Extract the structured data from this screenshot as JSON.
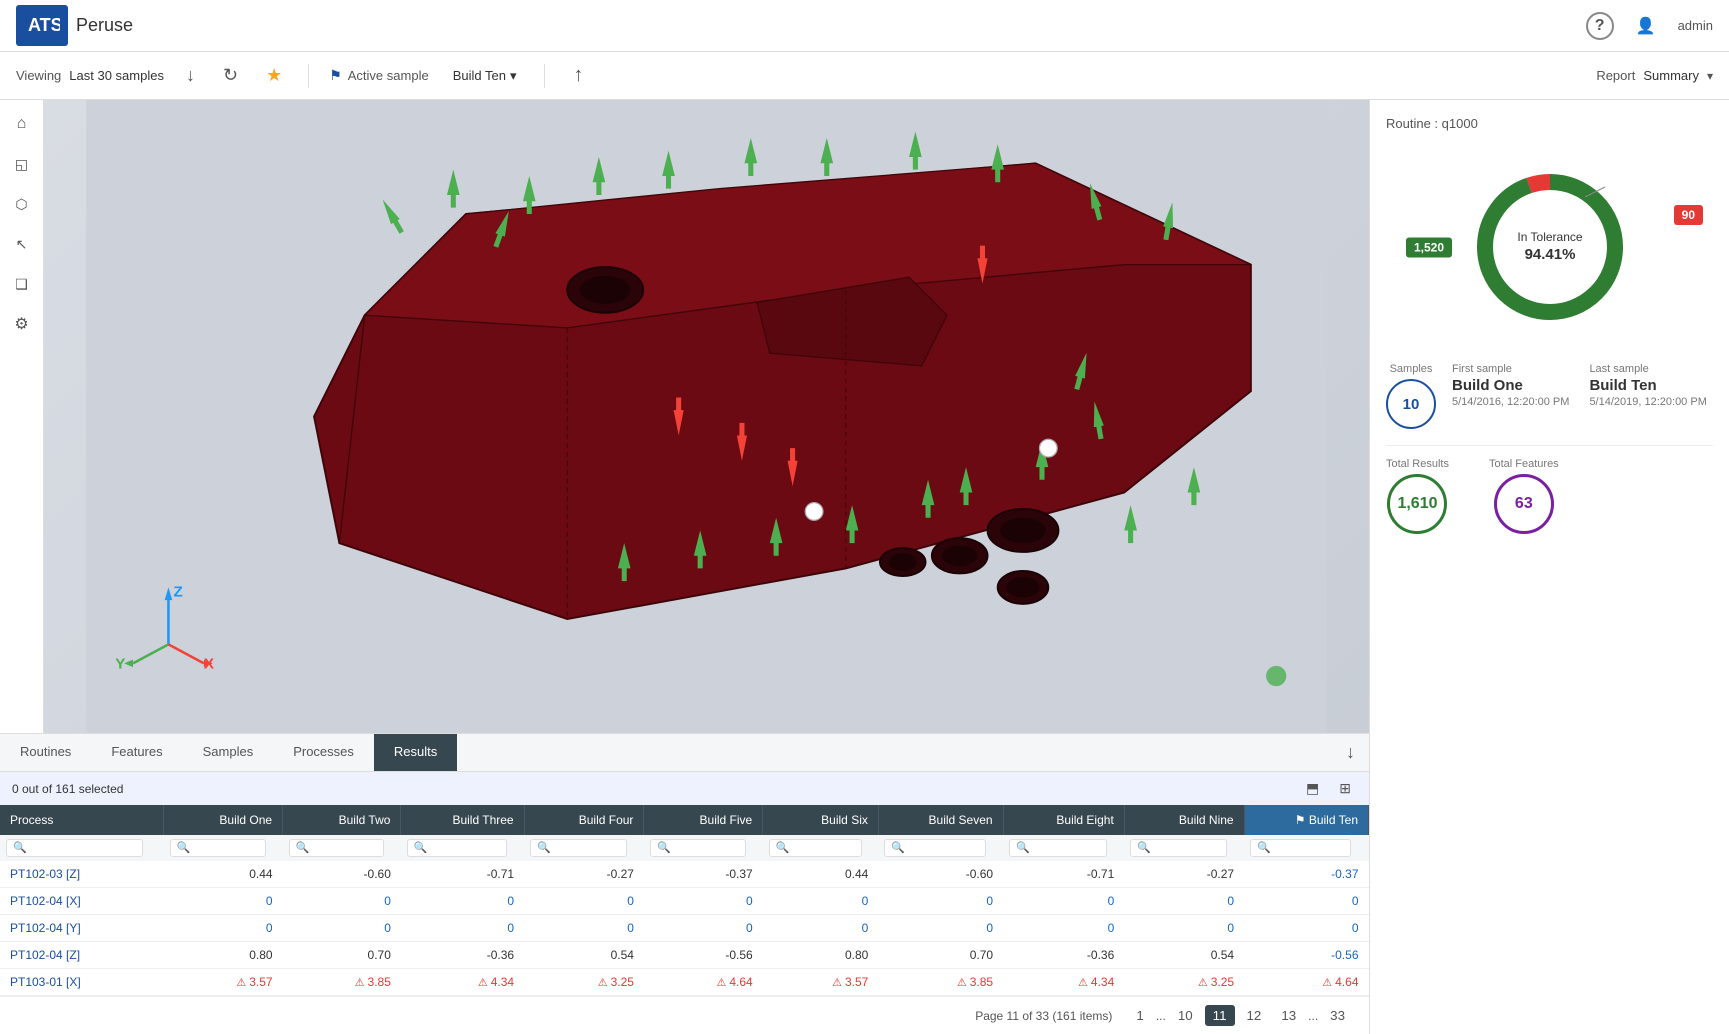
{
  "app": {
    "logo_text": "ATS",
    "app_name": "Peruse",
    "help_icon": "?",
    "user_icon": "👤",
    "admin_label": "admin"
  },
  "toolbar": {
    "viewing_label": "Viewing",
    "viewing_value": "Last 30 samples",
    "download_icon": "↓",
    "refresh_icon": "↻",
    "star_icon": "★",
    "active_sample_label": "Active sample",
    "build_value": "Build Ten",
    "dropdown_icon": "▾",
    "upload_icon": "↑",
    "report_label": "Report",
    "report_value": "Summary"
  },
  "side_tools": [
    {
      "name": "home",
      "icon": "⌂"
    },
    {
      "name": "measure",
      "icon": "◱"
    },
    {
      "name": "cube",
      "icon": "⬡"
    },
    {
      "name": "cursor",
      "icon": "↖"
    },
    {
      "name": "copy",
      "icon": "❑"
    },
    {
      "name": "settings",
      "icon": "⚙"
    }
  ],
  "summary": {
    "routine_label": "Routine : q1000",
    "donut": {
      "in_tolerance_label": "In Tolerance",
      "percentage": "94.41%",
      "green_count": "1,520",
      "red_count": "90",
      "green_color": "#2e7d32",
      "red_color": "#e53935"
    },
    "samples_label": "Samples",
    "samples_count": "10",
    "first_sample_label": "First sample",
    "first_sample_name": "Build One",
    "first_sample_date": "5/14/2016, 12:20:00 PM",
    "last_sample_label": "Last sample",
    "last_sample_name": "Build Ten",
    "last_sample_date": "5/14/2019, 12:20:00 PM",
    "total_results_label": "Total Results",
    "total_results_value": "1,610",
    "total_features_label": "Total Features",
    "total_features_value": "63"
  },
  "tabs": [
    {
      "id": "routines",
      "label": "Routines",
      "active": false
    },
    {
      "id": "features",
      "label": "Features",
      "active": false
    },
    {
      "id": "samples",
      "label": "Samples",
      "active": false
    },
    {
      "id": "processes",
      "label": "Processes",
      "active": false
    },
    {
      "id": "results",
      "label": "Results",
      "active": true
    }
  ],
  "table": {
    "status_text": "0 out of 161 selected",
    "columns": [
      "Process",
      "Build One",
      "Build Two",
      "Build Three",
      "Build Four",
      "Build Five",
      "Build Six",
      "Build Seven",
      "Build Eight",
      "Build Nine",
      "Build Ten"
    ],
    "rows": [
      {
        "process": "PT102-03 [Z]",
        "values": [
          "0.44",
          "-0.60",
          "-0.71",
          "-0.27",
          "-0.37",
          "0.44",
          "-0.60",
          "-0.71",
          "-0.27",
          "-0.37"
        ],
        "errors": []
      },
      {
        "process": "PT102-04 [X]",
        "values": [
          "0",
          "0",
          "0",
          "0",
          "0",
          "0",
          "0",
          "0",
          "0",
          "0"
        ],
        "errors": [],
        "green": true
      },
      {
        "process": "PT102-04 [Y]",
        "values": [
          "0",
          "0",
          "0",
          "0",
          "0",
          "0",
          "0",
          "0",
          "0",
          "0"
        ],
        "errors": [],
        "green": true
      },
      {
        "process": "PT102-04 [Z]",
        "values": [
          "0.80",
          "0.70",
          "-0.36",
          "0.54",
          "-0.56",
          "0.80",
          "0.70",
          "-0.36",
          "0.54",
          "-0.56"
        ],
        "errors": []
      },
      {
        "process": "PT103-01 [X]",
        "values": [
          "3.57",
          "3.85",
          "4.34",
          "3.25",
          "4.64",
          "3.57",
          "3.85",
          "4.34",
          "3.25",
          "4.64"
        ],
        "errors": [
          0,
          1,
          2,
          3,
          4,
          5,
          6,
          7,
          8,
          9
        ]
      }
    ]
  },
  "pagination": {
    "page_info": "Page 11 of 33 (161 items)",
    "pages": [
      "1",
      "...",
      "10",
      "11",
      "12",
      "13",
      "...",
      "33"
    ]
  }
}
